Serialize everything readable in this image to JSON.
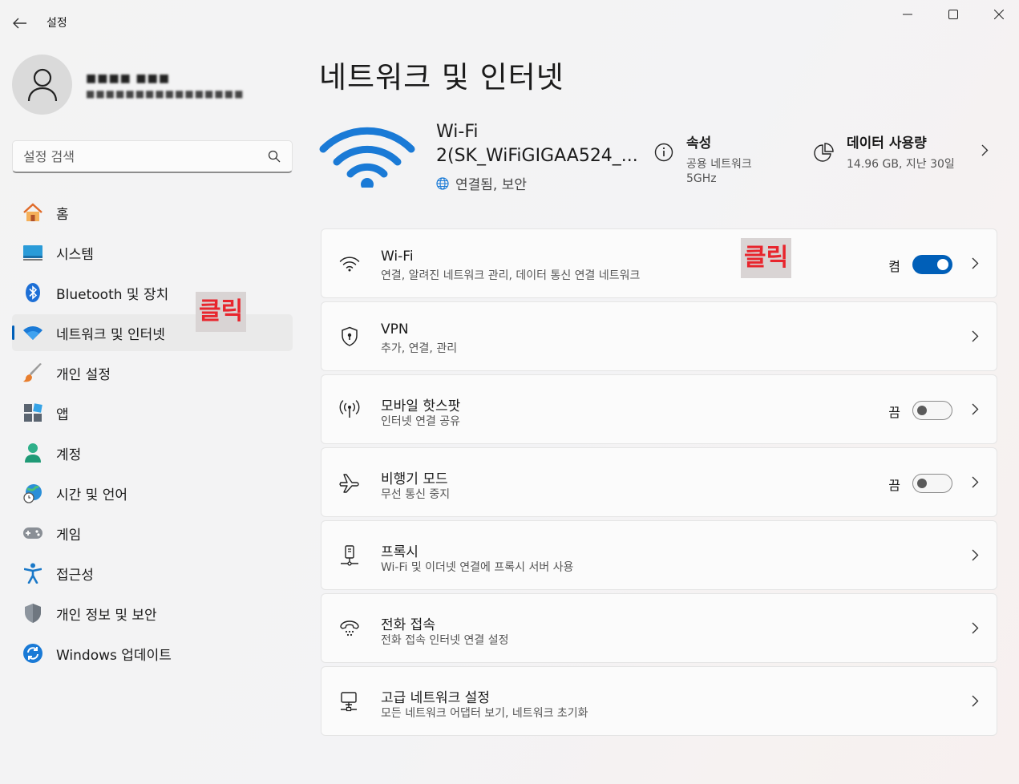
{
  "window": {
    "title": "설정"
  },
  "profile": {
    "name": "■■■■ ■■■",
    "email": "■■■■■■■■■■■■■■■■"
  },
  "search": {
    "placeholder": "설정 검색"
  },
  "sidebar": {
    "items": [
      {
        "label": "홈",
        "icon": "home-icon"
      },
      {
        "label": "시스템",
        "icon": "system-icon"
      },
      {
        "label": "Bluetooth 및 장치",
        "icon": "bluetooth-icon"
      },
      {
        "label": "네트워크 및 인터넷",
        "icon": "network-icon",
        "active": true
      },
      {
        "label": "개인 설정",
        "icon": "brush-icon"
      },
      {
        "label": "앱",
        "icon": "apps-icon"
      },
      {
        "label": "계정",
        "icon": "account-icon"
      },
      {
        "label": "시간 및 언어",
        "icon": "time-language-icon"
      },
      {
        "label": "게임",
        "icon": "gamepad-icon"
      },
      {
        "label": "접근성",
        "icon": "accessibility-icon"
      },
      {
        "label": "개인 정보 및 보안",
        "icon": "shield-icon"
      },
      {
        "label": "Windows 업데이트",
        "icon": "update-icon"
      }
    ]
  },
  "annotations": {
    "nav_click": "클릭",
    "wifi_click": "클릭"
  },
  "main": {
    "title": "네트워크 및 인터넷",
    "hero": {
      "ssid_line1": "Wi-Fi",
      "ssid_line2": "2(SK_WiFiGIGAA524_...",
      "status": "연결됨, 보안",
      "properties": {
        "title": "속성",
        "network": "공용 네트워크",
        "band": "5GHz"
      },
      "data_usage": {
        "title": "데이터 사용량",
        "value": "14.96 GB, 지난 30일"
      }
    },
    "cards": [
      {
        "title": "Wi-Fi",
        "subtitle": "연결, 알려진 네트워크 관리, 데이터 통신 연결 네트워크",
        "toggle": "on",
        "toggle_label": "켬"
      },
      {
        "title": "VPN",
        "subtitle": "추가, 연결, 관리"
      },
      {
        "title": "모바일 핫스팟",
        "subtitle": "인터넷 연결 공유",
        "toggle": "off",
        "toggle_label": "끔"
      },
      {
        "title": "비행기 모드",
        "subtitle": "무선 통신 중지",
        "toggle": "off",
        "toggle_label": "끔"
      },
      {
        "title": "프록시",
        "subtitle": "Wi-Fi 및 이더넷 연결에 프록시 서버 사용"
      },
      {
        "title": "전화 접속",
        "subtitle": "전화 접속 인터넷 연결 설정"
      },
      {
        "title": "고급 네트워크 설정",
        "subtitle": "모든 네트워크 어댑터 보기, 네트워크 초기화"
      }
    ]
  },
  "colors": {
    "accent": "#005fb8",
    "annotation": "#e8252d"
  }
}
